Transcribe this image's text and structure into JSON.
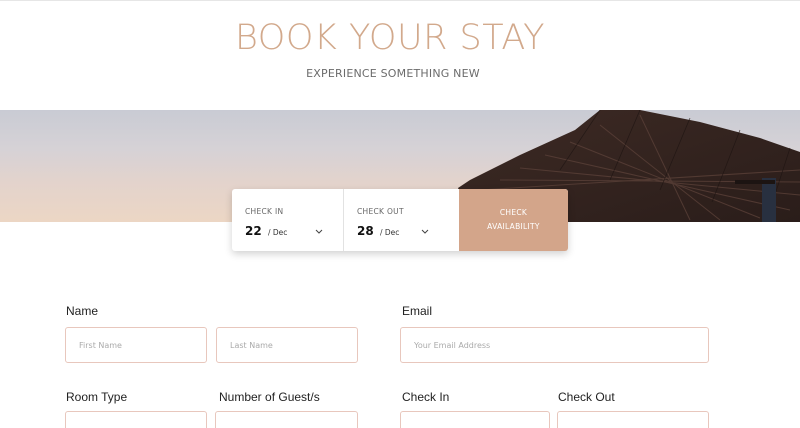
{
  "hero": {
    "title": "BOOK YOUR STAY",
    "subtitle": "EXPERIENCE SOMETHING NEW"
  },
  "booking_bar": {
    "check_in": {
      "label": "CHECK IN",
      "day": "22",
      "month": "/ Dec"
    },
    "check_out": {
      "label": "CHECK OUT",
      "day": "28",
      "month": "/ Dec"
    },
    "button": {
      "line1": "CHECK",
      "line2": "AVAILABILITY"
    }
  },
  "form": {
    "name_label": "Name",
    "first_name_placeholder": "First Name",
    "last_name_placeholder": "Last Name",
    "email_label": "Email",
    "email_placeholder": "Your Email Address",
    "room_type_label": "Room Type",
    "guests_label": "Number of Guest/s",
    "check_in_label": "Check In",
    "check_out_label": "Check Out"
  },
  "colors": {
    "accent": "#d3a58a",
    "title": "#d2a98c",
    "input_border": "#e8c7bd"
  },
  "icons": [
    "chevron-down-icon"
  ]
}
